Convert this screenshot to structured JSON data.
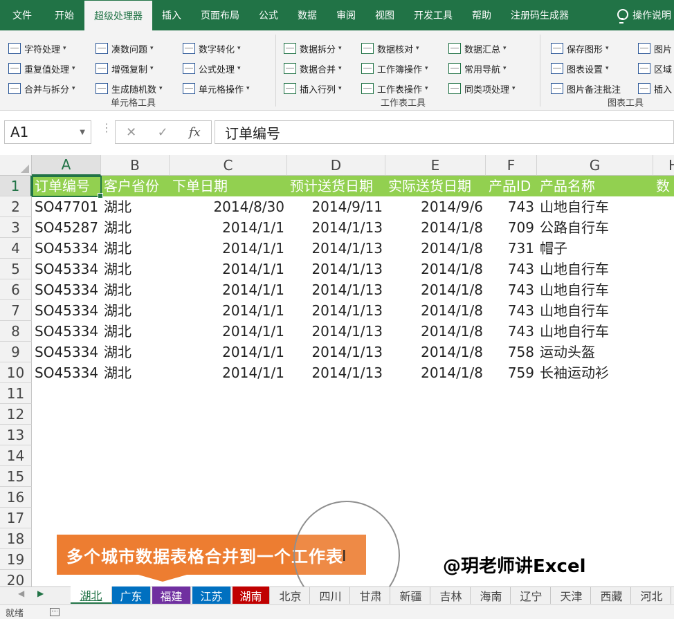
{
  "ribbon_tabs": [
    "文件",
    "开始",
    "超级处理器",
    "插入",
    "页面布局",
    "公式",
    "数据",
    "审阅",
    "视图",
    "开发工具",
    "帮助",
    "注册码生成器"
  ],
  "active_tab": "超级处理器",
  "tell_me": "操作说明",
  "ribbon": {
    "cell_tools": {
      "label": "单元格工具",
      "items": [
        "字符处理",
        "重复值处理",
        "合并与拆分",
        "凑数问题",
        "增强复制",
        "生成随机数",
        "数字转化",
        "公式处理",
        "单元格操作"
      ]
    },
    "sheet_tools": {
      "label": "工作表工具",
      "items": [
        "数据拆分",
        "数据合并",
        "插入行列",
        "数据核对",
        "工作簿操作",
        "工作表操作",
        "数据汇总",
        "常用导航",
        "同类项处理"
      ]
    },
    "chart_tools": {
      "label": "图表工具",
      "items": [
        "保存图形",
        "图表设置",
        "图片备注批注",
        "图片",
        "区域",
        "插入"
      ]
    }
  },
  "formula_bar": {
    "name_box": "A1",
    "content": "订单编号"
  },
  "columns": [
    "A",
    "B",
    "C",
    "D",
    "E",
    "F",
    "G",
    "H"
  ],
  "row_numbers": [
    "1",
    "2",
    "3",
    "4",
    "5",
    "6",
    "7",
    "8",
    "9",
    "10",
    "11",
    "12",
    "13",
    "14",
    "15",
    "16",
    "17",
    "18",
    "19",
    "20"
  ],
  "table": {
    "headers": [
      "订单编号",
      "客户省份",
      "下单日期",
      "预计送货日期",
      "实际送货日期",
      "产品ID",
      "产品名称",
      "数"
    ],
    "rows": [
      [
        "SO47701",
        "湖北",
        "2014/8/30",
        "2014/9/11",
        "2014/9/6",
        "743",
        "山地自行车"
      ],
      [
        "SO45287",
        "湖北",
        "2014/1/1",
        "2014/1/13",
        "2014/1/8",
        "709",
        "公路自行车"
      ],
      [
        "SO45334",
        "湖北",
        "2014/1/1",
        "2014/1/13",
        "2014/1/8",
        "731",
        "帽子"
      ],
      [
        "SO45334",
        "湖北",
        "2014/1/1",
        "2014/1/13",
        "2014/1/8",
        "743",
        "山地自行车"
      ],
      [
        "SO45334",
        "湖北",
        "2014/1/1",
        "2014/1/13",
        "2014/1/8",
        "743",
        "山地自行车"
      ],
      [
        "SO45334",
        "湖北",
        "2014/1/1",
        "2014/1/13",
        "2014/1/8",
        "743",
        "山地自行车"
      ],
      [
        "SO45334",
        "湖北",
        "2014/1/1",
        "2014/1/13",
        "2014/1/8",
        "743",
        "山地自行车"
      ],
      [
        "SO45334",
        "湖北",
        "2014/1/1",
        "2014/1/13",
        "2014/1/8",
        "758",
        "运动头盔"
      ],
      [
        "SO45334",
        "湖北",
        "2014/1/1",
        "2014/1/13",
        "2014/1/8",
        "759",
        "长袖运动衫"
      ]
    ]
  },
  "overlay": {
    "banner": "多个城市数据表格合并到一个工作表",
    "watermark": "@玥老师讲Excel"
  },
  "sheet_tabs": [
    {
      "name": "湖北",
      "color": "#ffffff",
      "active": true
    },
    {
      "name": "广东",
      "color": "#0070c0"
    },
    {
      "name": "福建",
      "color": "#7030a0"
    },
    {
      "name": "江苏",
      "color": "#0070c0"
    },
    {
      "name": "湖南",
      "color": "#c00000"
    },
    {
      "name": "北京"
    },
    {
      "name": "四川"
    },
    {
      "name": "甘肃"
    },
    {
      "name": "新疆"
    },
    {
      "name": "吉林"
    },
    {
      "name": "海南"
    },
    {
      "name": "辽宁"
    },
    {
      "name": "天津"
    },
    {
      "name": "西藏"
    },
    {
      "name": "河北"
    }
  ],
  "status": "就绪",
  "colors": {
    "excel_green": "#217346",
    "header_fill": "#92d050",
    "banner": "#ed7d31"
  }
}
